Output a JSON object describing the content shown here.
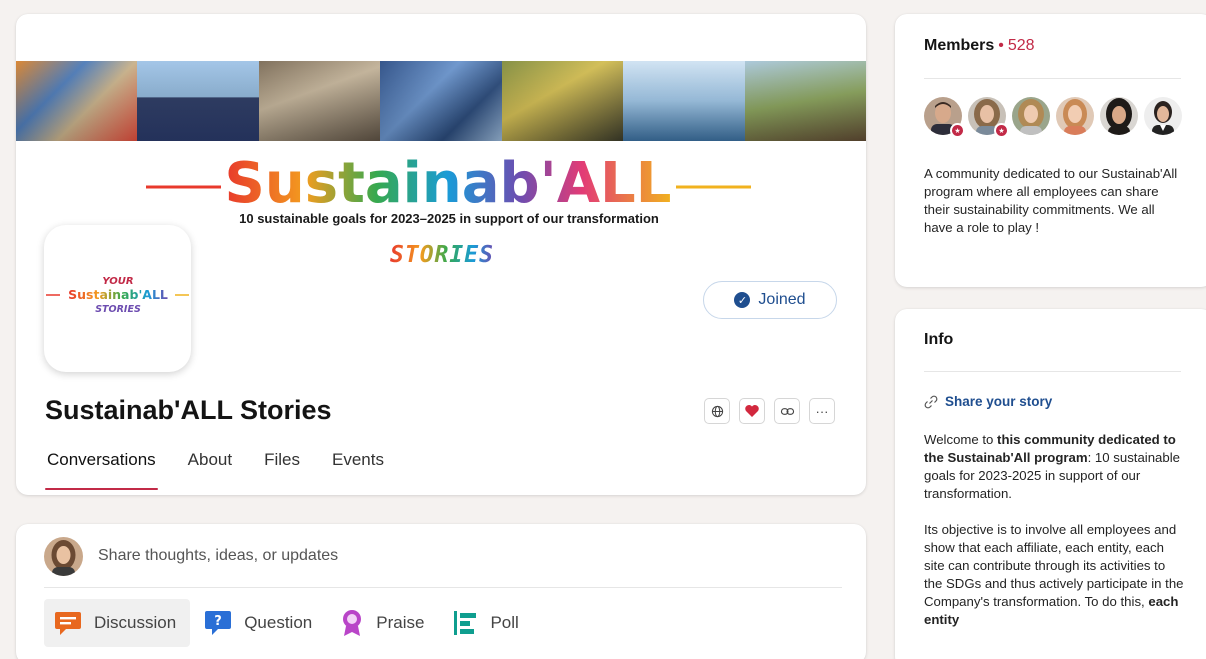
{
  "header": {
    "banner_title": "Sustainab'ALL",
    "banner_subtitle": "10 sustainable goals for 2023–2025 in support of our transformation",
    "banner_stories": "STORIES",
    "logo_line1": "YOUR",
    "logo_line2": "Sustainab'ALL",
    "logo_line3": "STORIES",
    "joined_label": "Joined",
    "community_name": "Sustainab'ALL Stories",
    "tabs": [
      {
        "label": "Conversations",
        "active": true
      },
      {
        "label": "About",
        "active": false
      },
      {
        "label": "Files",
        "active": false
      },
      {
        "label": "Events",
        "active": false
      }
    ],
    "icon_buttons": [
      "globe-icon",
      "heart-icon",
      "link-icon",
      "more-icon"
    ],
    "more_label": "···"
  },
  "composer": {
    "placeholder": "Share thoughts, ideas, or updates",
    "post_types": [
      {
        "label": "Discussion",
        "icon": "discussion-icon",
        "color": "#e8681f"
      },
      {
        "label": "Question",
        "icon": "question-icon",
        "color": "#2a6fd6"
      },
      {
        "label": "Praise",
        "icon": "praise-icon",
        "color": "#b945c8"
      },
      {
        "label": "Poll",
        "icon": "poll-icon",
        "color": "#0f9e8f"
      }
    ]
  },
  "members": {
    "title": "Members",
    "separator": "•",
    "count": "528",
    "description": "A community dedicated to our Sustainab'All program where all employees can share their sustainability commitments. We all have a role to play !"
  },
  "info": {
    "title": "Info",
    "share_link": "Share your story",
    "p1_a": "Welcome to ",
    "p1_bold": "this community dedicated to the Sustainab'All program",
    "p1_b": ": 10 sustainable goals for 2023-2025 in support of our transformation.",
    "p2_a": "Its objective is to involve all employees and show that each affiliate, each entity, each site can contribute through its activities to the SDGs and thus actively participate in the Company's transformation. To do this, ",
    "p2_bold": "each entity"
  },
  "colors": {
    "accent": "#c22a47",
    "link": "#1f4e8f"
  }
}
